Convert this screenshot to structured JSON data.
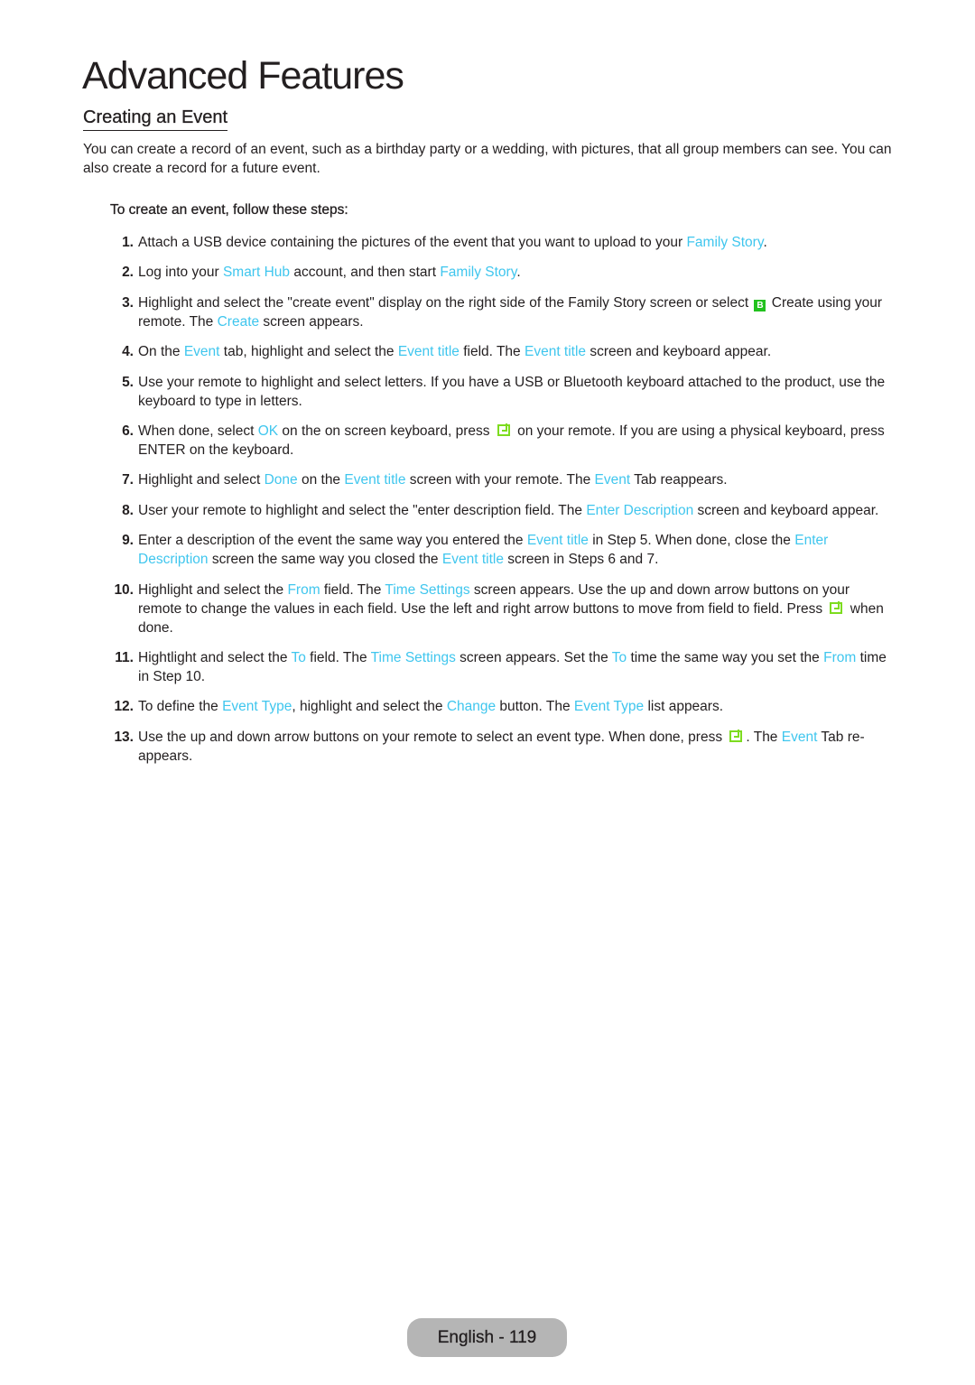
{
  "page": {
    "title": "Advanced Features",
    "section_title": "Creating an Event",
    "intro": "You can create a record of an event, such as a birthday party or a wedding, with pictures, that all group members can see. You can also create a record for a future event.",
    "steps_heading": "To create an event, follow these steps:",
    "highlight_color": "#3fc6ee",
    "steps": [
      {
        "num": "1.",
        "parts": [
          {
            "t": "Attach a USB device containing the pictures of the event that you want to upload to your "
          },
          {
            "t": "Family Story",
            "hl": true
          },
          {
            "t": "."
          }
        ]
      },
      {
        "num": "2.",
        "parts": [
          {
            "t": "Log into your "
          },
          {
            "t": "Smart Hub",
            "hl": true
          },
          {
            "t": " account, and then start "
          },
          {
            "t": "Family Story",
            "hl": true
          },
          {
            "t": "."
          }
        ]
      },
      {
        "num": "3.",
        "parts": [
          {
            "t": "Highlight and select the \"create event\" display on the right side of the Family Story screen or select "
          },
          {
            "icon": "b-button-icon"
          },
          {
            "t": " Create using your remote. The "
          },
          {
            "t": "Create",
            "hl": true
          },
          {
            "t": " screen appears."
          }
        ]
      },
      {
        "num": "4.",
        "parts": [
          {
            "t": "On the "
          },
          {
            "t": "Event",
            "hl": true
          },
          {
            "t": " tab, highlight and select the "
          },
          {
            "t": "Event title",
            "hl": true
          },
          {
            "t": " field. The "
          },
          {
            "t": "Event title",
            "hl": true
          },
          {
            "t": " screen and keyboard appear."
          }
        ]
      },
      {
        "num": "5.",
        "parts": [
          {
            "t": "Use your remote to highlight and select letters. If you have a USB or Bluetooth keyboard attached to the product, use the keyboard to type in letters."
          }
        ]
      },
      {
        "num": "6.",
        "parts": [
          {
            "t": "When done, select "
          },
          {
            "t": "OK",
            "hl": true
          },
          {
            "t": " on the on screen keyboard, press "
          },
          {
            "icon": "enter-key-icon"
          },
          {
            "t": " on your remote. If you are using a physical keyboard, press ENTER on the keyboard."
          }
        ]
      },
      {
        "num": "7.",
        "parts": [
          {
            "t": "Highlight and select "
          },
          {
            "t": "Done",
            "hl": true
          },
          {
            "t": " on the "
          },
          {
            "t": "Event title",
            "hl": true
          },
          {
            "t": " screen with your remote. The "
          },
          {
            "t": "Event",
            "hl": true
          },
          {
            "t": " Tab reappears."
          }
        ]
      },
      {
        "num": "8.",
        "parts": [
          {
            "t": "User your remote to highlight and select the \"enter description field. The "
          },
          {
            "t": "Enter Description",
            "hl": true
          },
          {
            "t": " screen and keyboard appear."
          }
        ]
      },
      {
        "num": "9.",
        "parts": [
          {
            "t": "Enter a description of the event the same way you entered the "
          },
          {
            "t": "Event title",
            "hl": true
          },
          {
            "t": " in Step 5. When done, close the "
          },
          {
            "t": "Enter Description",
            "hl": true
          },
          {
            "t": " screen the same way you closed the "
          },
          {
            "t": "Event title",
            "hl": true
          },
          {
            "t": " screen in Steps 6 and 7."
          }
        ]
      },
      {
        "num": "10.",
        "parts": [
          {
            "t": "Highlight and select the "
          },
          {
            "t": "From",
            "hl": true
          },
          {
            "t": " field. The "
          },
          {
            "t": "Time Settings",
            "hl": true
          },
          {
            "t": " screen appears. Use the up and down arrow buttons on your remote to change the values in each field. Use the left and right arrow buttons to move from field to field. Press "
          },
          {
            "icon": "enter-key-icon"
          },
          {
            "t": " when done."
          }
        ]
      },
      {
        "num": "11.",
        "parts": [
          {
            "t": "Hightlight and select the "
          },
          {
            "t": "To",
            "hl": true
          },
          {
            "t": " field. The "
          },
          {
            "t": "Time Settings",
            "hl": true
          },
          {
            "t": " screen appears. Set the "
          },
          {
            "t": "To",
            "hl": true
          },
          {
            "t": " time the same way you set the "
          },
          {
            "t": "From",
            "hl": true
          },
          {
            "t": " time in Step 10."
          }
        ]
      },
      {
        "num": "12.",
        "parts": [
          {
            "t": "To define the "
          },
          {
            "t": "Event Type",
            "hl": true
          },
          {
            "t": ", highlight and select the "
          },
          {
            "t": "Change",
            "hl": true
          },
          {
            "t": " button. The "
          },
          {
            "t": "Event Type",
            "hl": true
          },
          {
            "t": " list appears."
          }
        ]
      },
      {
        "num": "13.",
        "parts": [
          {
            "t": "Use the up and down arrow buttons on your remote to select an event type. When done, press "
          },
          {
            "icon": "enter-key-icon"
          },
          {
            "t": ". The "
          },
          {
            "t": "Event",
            "hl": true
          },
          {
            "t": " Tab re-appears."
          }
        ]
      }
    ],
    "footer": "English - 119"
  }
}
